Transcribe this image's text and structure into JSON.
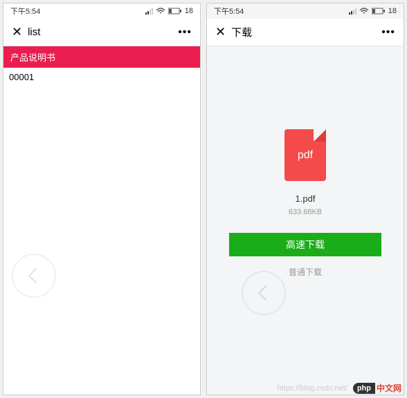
{
  "status": {
    "time": "下午5:54",
    "battery": "18"
  },
  "left": {
    "nav": {
      "title": "list",
      "more": "•••"
    },
    "section_header": "产品说明书",
    "items": [
      "00001"
    ]
  },
  "right": {
    "nav": {
      "title": "下载",
      "more": "•••"
    },
    "file": {
      "icon_text": "pdf",
      "name": "1.pdf",
      "size": "633.68KB"
    },
    "actions": {
      "primary": "高速下载",
      "secondary": "普通下载"
    }
  },
  "watermark": {
    "url": "https://blog.csdn.net/",
    "logo": "php",
    "text": "中文网"
  }
}
